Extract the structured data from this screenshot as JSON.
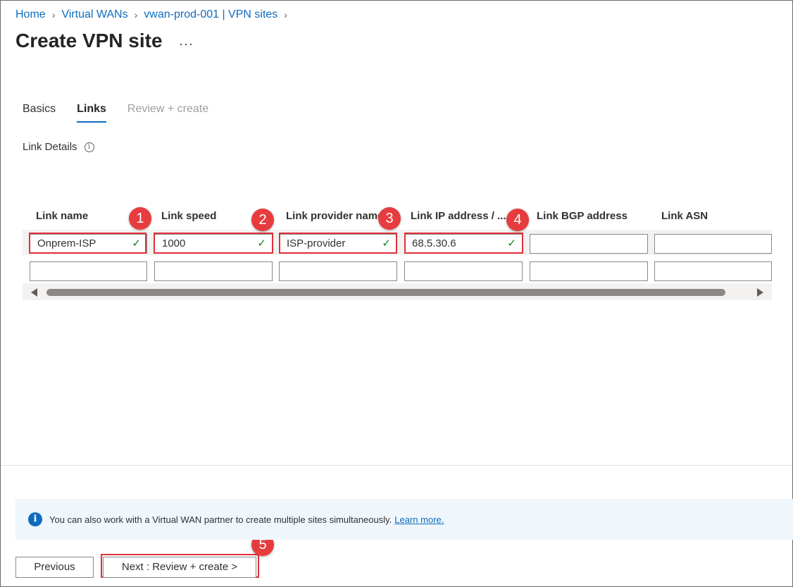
{
  "breadcrumb": [
    "Home",
    "Virtual WANs",
    "vwan-prod-001 | VPN sites"
  ],
  "page_title": "Create VPN site",
  "title_more": "···",
  "tabs": [
    {
      "label": "Basics",
      "state": "normal"
    },
    {
      "label": "Links",
      "state": "active"
    },
    {
      "label": "Review + create",
      "state": "disabled"
    }
  ],
  "section_label": "Link Details",
  "info_icon_glyph": "i",
  "grid": {
    "columns": [
      "Link name",
      "Link speed",
      "Link provider name",
      "Link IP address / ...",
      "Link BGP address",
      "Link ASN"
    ],
    "rows": [
      [
        "Onprem-ISP",
        "1000",
        "ISP-provider",
        "68.5.30.6",
        "",
        ""
      ],
      [
        "",
        "",
        "",
        "",
        "",
        ""
      ]
    ]
  },
  "annotations": [
    "1",
    "2",
    "3",
    "4",
    "5"
  ],
  "info_bar": {
    "text": "You can also work with a Virtual WAN partner to create multiple sites simultaneously.",
    "link": "Learn more."
  },
  "buttons": {
    "previous": "Previous",
    "next": "Next : Review + create >"
  },
  "colors": {
    "accent": "#0f6cbd",
    "highlight": "#e0303a",
    "badge": "#e73c3e",
    "valid": "#107c10"
  }
}
